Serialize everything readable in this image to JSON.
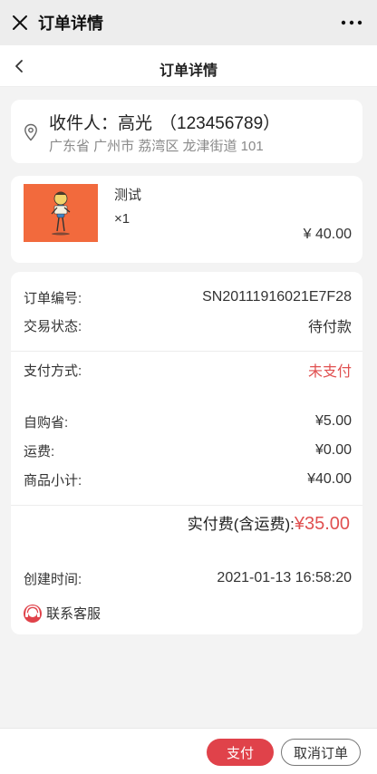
{
  "wechat": {
    "title": "订单详情",
    "more": "•••"
  },
  "nav": {
    "title": "订单详情"
  },
  "address": {
    "recipient_label": "收件人：",
    "recipient_name": "高光",
    "phone": "（123456789）",
    "full_address": "广东省 广州市 荔湾区 龙津街道 101"
  },
  "product": {
    "name": "测试",
    "quantity": "×1",
    "price": "¥ 40.00"
  },
  "order": {
    "number_label": "订单编号:",
    "number_value": "SN20111916021E7F28",
    "status_label": "交易状态:",
    "status_value": "待付款",
    "payment_label": "支付方式:",
    "payment_value": "未支付",
    "self_save_label": "自购省:",
    "self_save_value": "¥5.00",
    "shipping_label": "运费:",
    "shipping_value": "¥0.00",
    "subtotal_label": "商品小计:",
    "subtotal_value": "¥40.00",
    "total_label": "实付费(含运费):",
    "total_value": "¥35.00",
    "created_label": "创建时间:",
    "created_value": "2021-01-13 16:58:20"
  },
  "service": {
    "label": "联系客服"
  },
  "actions": {
    "pay": "支付",
    "cancel": "取消订单"
  },
  "colors": {
    "accent": "#e0424a",
    "unpaid": "#e05050",
    "thumb": "#f26a3d"
  }
}
